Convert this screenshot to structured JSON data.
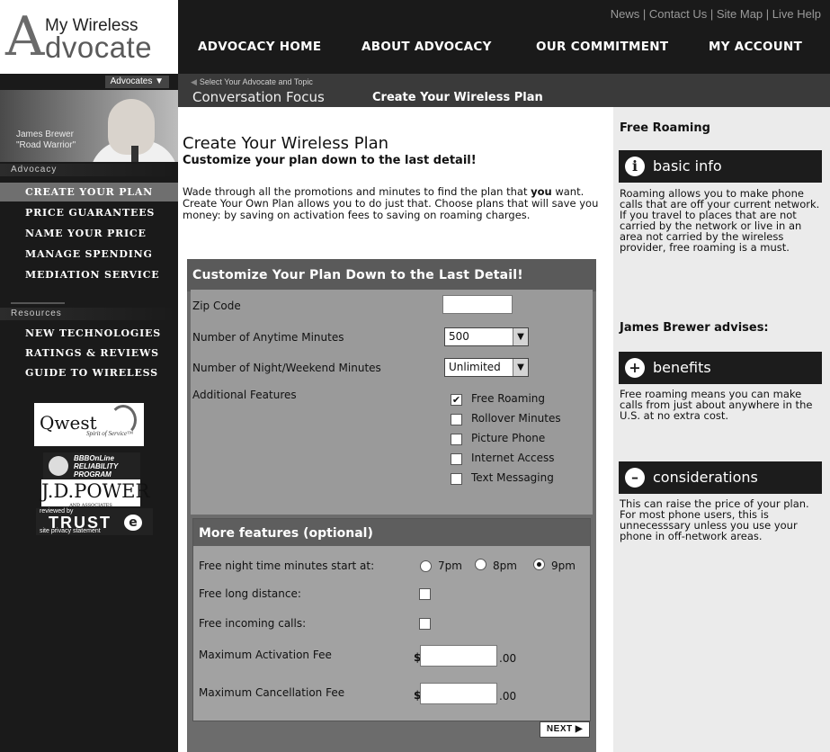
{
  "logo": {
    "letter": "A",
    "line1": "My Wireless",
    "line2": "dvocate"
  },
  "header": {
    "utility_links": [
      "News",
      "Contact Us",
      "Site Map",
      "Live Help"
    ],
    "nav": [
      "ADVOCACY HOME",
      "ABOUT ADVOCACY",
      "OUR COMMITMENT",
      "MY ACCOUNT"
    ]
  },
  "advocate_select": {
    "label": "Advocates ▼"
  },
  "advocate": {
    "name_line1": "James Brewer",
    "name_line2": "\"Road Warrior\""
  },
  "sidebar": {
    "advocacy_heading": "Advocacy",
    "advocacy_items": [
      "CREATE YOUR PLAN",
      "PRICE GUARANTEES",
      "NAME YOUR PRICE",
      "MANAGE SPENDING",
      "MEDIATION SERVICE"
    ],
    "active_index": 0,
    "resources_heading": "Resources",
    "resources_items": [
      "NEW TECHNOLOGIES",
      "RATINGS & REVIEWS",
      "GUIDE TO WIRELESS"
    ]
  },
  "sponsors": {
    "qwest": "Qwest",
    "qwest_tag": "Spirit of Service™",
    "bbb": "BBBOnLine RELIABILITY PROGRAM",
    "bbb_lines": [
      "BBBOnLine",
      "RELIABILITY",
      "PROGRAM"
    ],
    "jdpower": "J.D.POWER",
    "jdpower_sub": "AND ASSOCIATES",
    "truste_top": "reviewed by",
    "truste_main": "TRUST",
    "truste_e": "e",
    "truste_sub": "site privacy statement"
  },
  "breadcrumb": {
    "small": "Select Your Advocate and Topic",
    "focus": "Conversation Focus",
    "title": "Create Your Wireless Plan"
  },
  "main": {
    "title": "Create Your Wireless Plan",
    "subtitle": "Customize your plan down to the last detail!",
    "intro_pre": "Wade through all the promotions and minutes to find the plan that ",
    "intro_bold": "you",
    "intro_post": " want. Create Your Own Plan allows you to do just that. Choose plans that will save you money: by saving on activation fees to saving on roaming charges."
  },
  "form": {
    "heading": "Customize Your Plan Down to the Last Detail!",
    "zip_label": "Zip Code",
    "zip_value": "",
    "anytime_label": "Number of Anytime Minutes",
    "anytime_value": "500",
    "night_label": "Number of Night/Weekend Minutes",
    "night_value": "Unlimited",
    "features_label": "Additional Features",
    "features": [
      {
        "label": "Free Roaming",
        "checked": true
      },
      {
        "label": "Rollover Minutes",
        "checked": false
      },
      {
        "label": "Picture Phone",
        "checked": false
      },
      {
        "label": "Internet Access",
        "checked": false
      },
      {
        "label": "Text Messaging",
        "checked": false
      }
    ],
    "more": {
      "heading": "More features (optional)",
      "night_start_label": "Free night time minutes start at:",
      "night_start_options": [
        "7pm",
        "8pm",
        "9pm"
      ],
      "night_start_selected": "9pm",
      "long_distance_label": "Free long distance:",
      "incoming_label": "Free incoming calls:",
      "activation_label": "Maximum Activation Fee",
      "cancellation_label": "Maximum Cancellation Fee",
      "currency": "$",
      "cents": ".00"
    },
    "next_label": "NEXT ▶"
  },
  "right": {
    "topic": "Free Roaming",
    "basic_heading": "basic info",
    "basic_icon": "i",
    "basic_text": "Roaming allows you to make phone calls that are off your current network. If you travel to places that are not carried by the network or live in an area not carried by the wireless provider, free roaming is a must.",
    "advises": "James Brewer advises:",
    "benefits_heading": "benefits",
    "benefits_icon": "+",
    "benefits_text": "Free roaming means you can make calls from just about anywhere in the U.S. at no extra cost.",
    "considerations_heading": "considerations",
    "considerations_icon": "–",
    "considerations_text": "This can raise the price of your plan. For most phone users, this is unnecesssary unless you use your phone in off-network areas."
  }
}
